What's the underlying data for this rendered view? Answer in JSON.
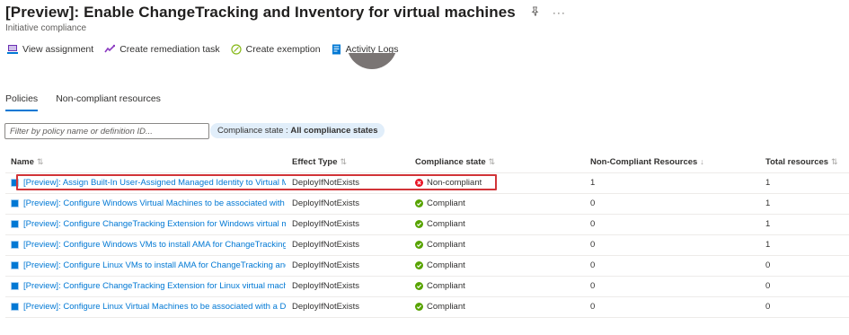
{
  "page": {
    "title": "[Preview]: Enable ChangeTracking and Inventory for virtual machines",
    "subtitle": "Initiative compliance",
    "pin_icon": "pin-icon",
    "more_icon": "ellipsis-icon"
  },
  "toolbar": {
    "items": [
      {
        "label": "View assignment",
        "icon": "view-assignment-icon"
      },
      {
        "label": "Create remediation task",
        "icon": "remediation-icon"
      },
      {
        "label": "Create exemption",
        "icon": "exemption-icon"
      },
      {
        "label": "Activity Logs",
        "icon": "activity-log-icon"
      }
    ]
  },
  "tabs": [
    {
      "label": "Policies",
      "active": true
    },
    {
      "label": "Non-compliant resources",
      "active": false
    }
  ],
  "filter": {
    "placeholder": "Filter by policy name or definition ID...",
    "value": ""
  },
  "pill": {
    "label": "Compliance state : ",
    "value": "All compliance states"
  },
  "table": {
    "columns": {
      "name": "Name",
      "effect": "Effect Type",
      "state": "Compliance state",
      "noncompliant": "Non-Compliant Resources",
      "total": "Total resources"
    },
    "rows": [
      {
        "name": "[Preview]: Assign Built-In User-Assigned Managed Identity to Virtual Machines",
        "effect": "DeployIfNotExists",
        "state": "Non-compliant",
        "noncompliant": "1",
        "total": "1"
      },
      {
        "name": "[Preview]: Configure Windows Virtual Machines to be associated with a Data Collection Rule",
        "effect": "DeployIfNotExists",
        "state": "Compliant",
        "noncompliant": "0",
        "total": "1"
      },
      {
        "name": "[Preview]: Configure ChangeTracking Extension for Windows virtual machines",
        "effect": "DeployIfNotExists",
        "state": "Compliant",
        "noncompliant": "0",
        "total": "1"
      },
      {
        "name": "[Preview]: Configure Windows VMs to install AMA for ChangeTracking and Inventory",
        "effect": "DeployIfNotExists",
        "state": "Compliant",
        "noncompliant": "0",
        "total": "1"
      },
      {
        "name": "[Preview]: Configure Linux VMs to install AMA for ChangeTracking and Inventory",
        "effect": "DeployIfNotExists",
        "state": "Compliant",
        "noncompliant": "0",
        "total": "0"
      },
      {
        "name": "[Preview]: Configure ChangeTracking Extension for Linux virtual machines",
        "effect": "DeployIfNotExists",
        "state": "Compliant",
        "noncompliant": "0",
        "total": "0"
      },
      {
        "name": "[Preview]: Configure Linux Virtual Machines to be associated with a Data Collection Rule",
        "effect": "DeployIfNotExists",
        "state": "Compliant",
        "noncompliant": "0",
        "total": "0"
      }
    ]
  },
  "colors": {
    "accent": "#0078d4",
    "compliant": "#57a300",
    "noncompliant": "#e81123",
    "highlight": "#d13438"
  }
}
